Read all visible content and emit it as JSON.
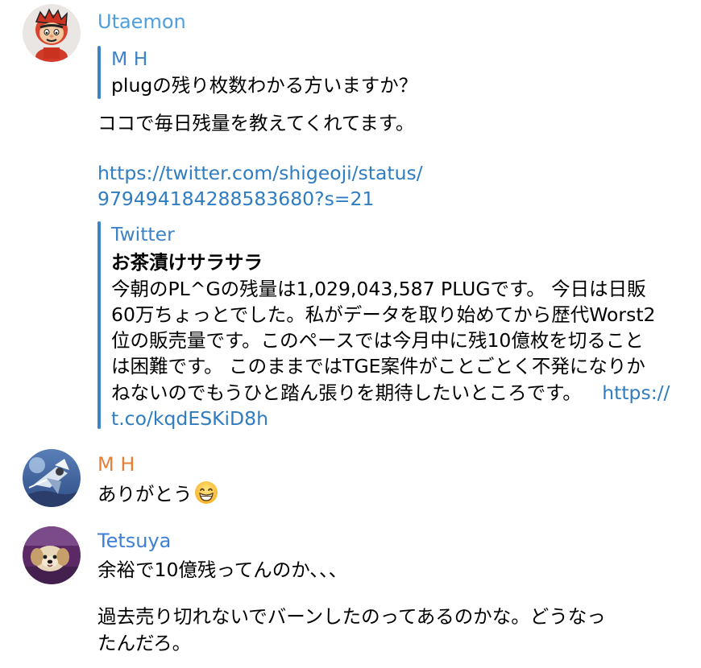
{
  "colors": {
    "utaemon_name": "#4f9fdc",
    "mh_name": "#e67e33",
    "tetsuya_name": "#3d7fd6",
    "quote_bar": "#3d83c6",
    "link": "#2f7cc1"
  },
  "messages": [
    {
      "sender": "Utaemon",
      "avatar_icon": "cartoon-character-avatar",
      "reply_quote": {
        "author": "M H",
        "text": "plugの残り枚数わかる方いますか？"
      },
      "body_line1": "ココで毎日残量を教えてくれてます。",
      "link_line1": "https://twitter.com/shigeoji/status/",
      "link_line2": "979494184288583680?s=21",
      "preview": {
        "site": "Twitter",
        "title": "お茶漬けサラサラ",
        "lines": [
          "今朝のPL^Gの残量は1,029,043,587 PLUGです。 今日は日販",
          "60万ちょっとでした。私がデータを取り始めてから歴代Worst2",
          "位の販売量です。このペースでは今月中に残10億枚を切ること",
          "は困難です。 このままではTGE案件がことごとく不発になりか",
          "ねないのでもうひと踏ん張りを期待したいところです。"
        ],
        "link_part1": "https://",
        "link_part2": "t.co/kqdESKiD8h"
      }
    },
    {
      "sender": "M H",
      "avatar_icon": "anime-scene-avatar",
      "text": "ありがとう",
      "emoji": "grinning-face-emoji"
    },
    {
      "sender": "Tetsuya",
      "avatar_icon": "dog-photo-avatar",
      "line1": "余裕で10億残ってんのか、、、",
      "line2": "過去売り切れないでバーンしたのってあるのかな。どうなっ",
      "line3": "たんだろ。"
    }
  ]
}
